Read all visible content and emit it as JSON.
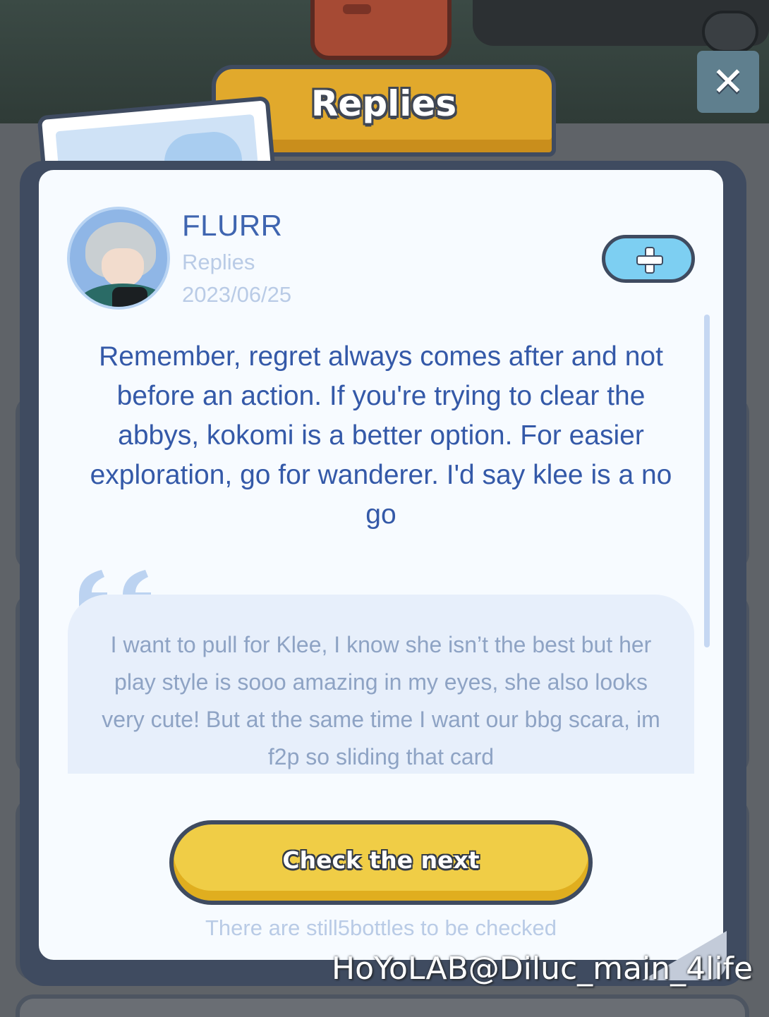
{
  "dialog": {
    "title": "Replies",
    "close_icon": "close-icon"
  },
  "reply": {
    "author_name": "FLURR",
    "subtitle": "Replies",
    "date": "2023/06/25",
    "add_icon": "plus-icon",
    "body": "Remember, regret always comes after and not before an action. If you're trying to clear the abbys, kokomi is a better option. For easier exploration, go for wanderer. I'd say klee is a no go"
  },
  "quote": {
    "icon": "quote-icon",
    "text": "I want to pull for Klee, I know she isn’t the best but her play style is sooo amazing in my eyes, she also looks very cute! But at the same time I want our bbg scara, im f2p so sliding that card"
  },
  "footer": {
    "next_button_label": "Check the next",
    "remaining_text": "There are still5bottles to be checked"
  },
  "watermark": "HoYoLAB@Diluc_main_4life",
  "colors": {
    "accent_yellow": "#f0cd46",
    "accent_blue": "#7dcff2",
    "text_blue": "#3459a8",
    "muted_blue": "#b9cbe6",
    "outline": "#3f4b60"
  }
}
